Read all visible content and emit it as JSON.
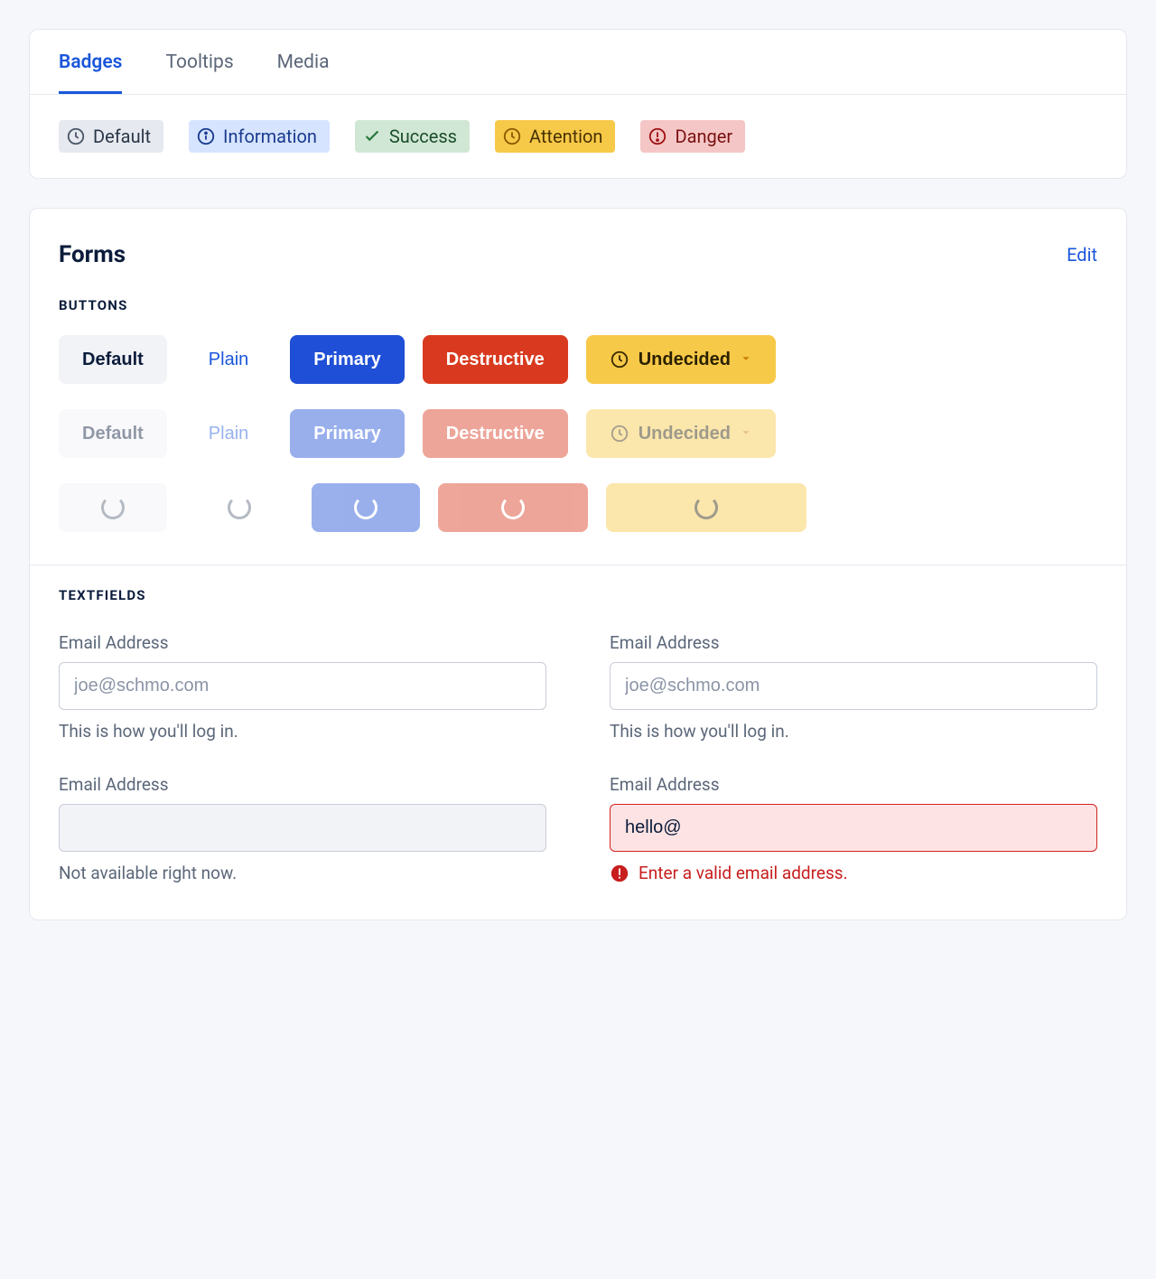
{
  "tabs": {
    "badges": "Badges",
    "tooltips": "Tooltips",
    "media": "Media"
  },
  "badges": {
    "default": "Default",
    "information": "Information",
    "success": "Success",
    "attention": "Attention",
    "danger": "Danger"
  },
  "forms": {
    "title": "Forms",
    "edit": "Edit",
    "buttons_heading": "Buttons",
    "textfields_heading": "Textfields",
    "buttons": {
      "default": "Default",
      "plain": "Plain",
      "primary": "Primary",
      "destructive": "Destructive",
      "undecided": "Undecided"
    },
    "fields": {
      "f1": {
        "label": "Email Address",
        "placeholder": "joe@schmo.com",
        "help": "This is how you'll log in."
      },
      "f2": {
        "label": "Email Address",
        "placeholder": "joe@schmo.com",
        "help": "This is how you'll log in."
      },
      "f3": {
        "label": "Email Address",
        "help": "Not available right now."
      },
      "f4": {
        "label": "Email Address",
        "value": "hello@",
        "error": "Enter a valid email address."
      }
    }
  }
}
